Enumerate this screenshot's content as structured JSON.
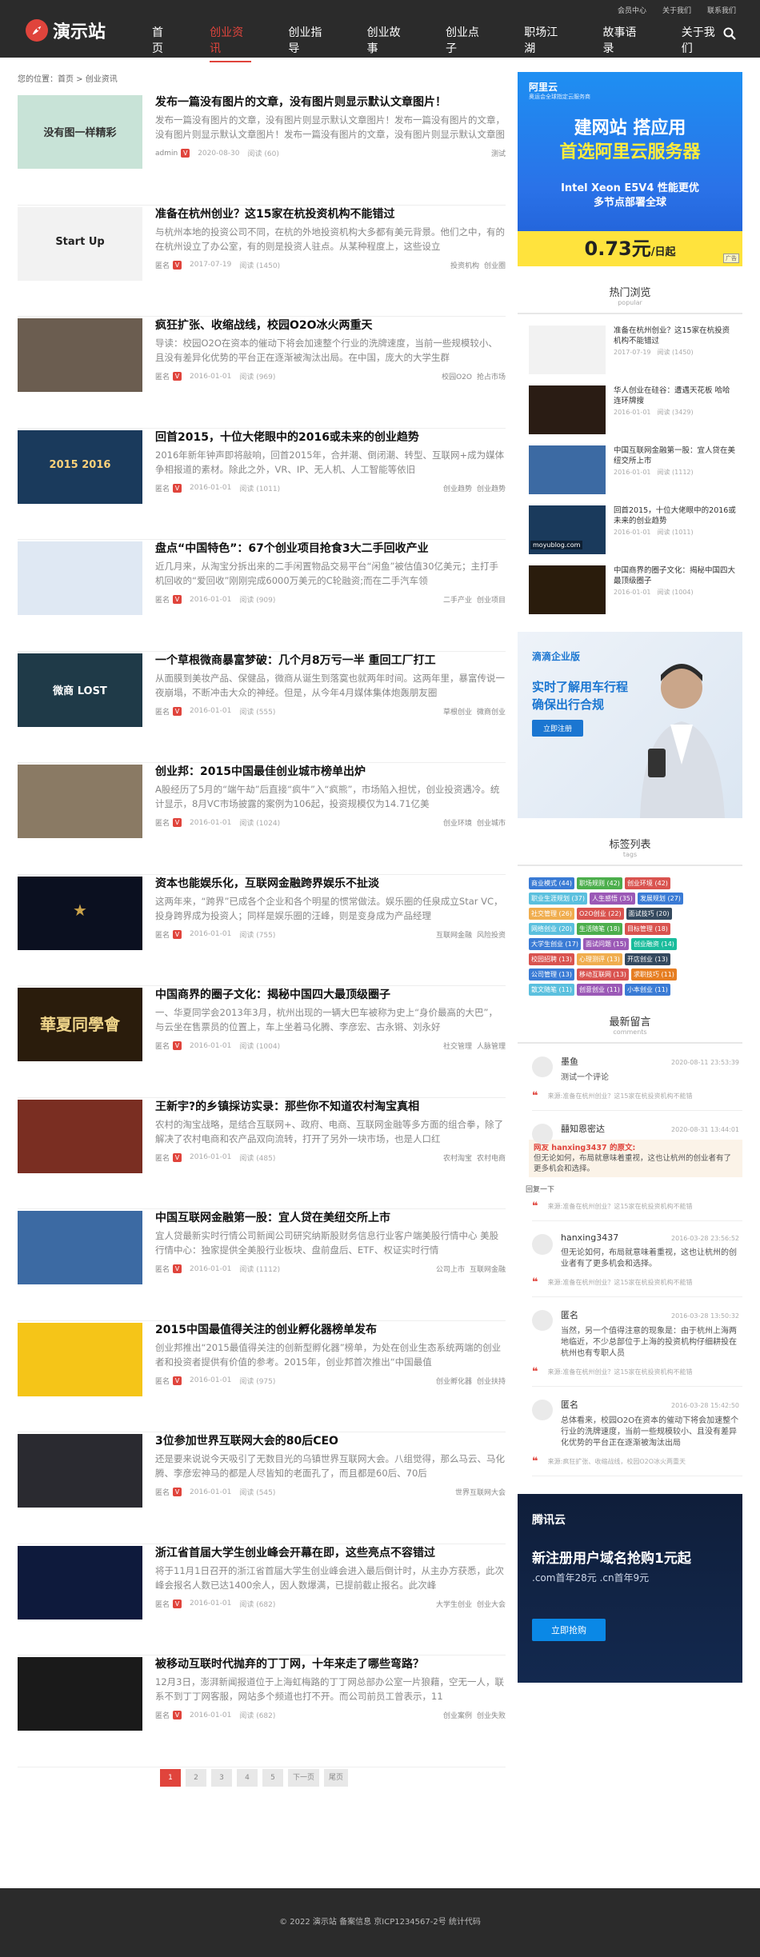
{
  "topbar": [
    "会员中心",
    "关于我们",
    "联系我们"
  ],
  "logo": {
    "text": "演示站"
  },
  "nav": [
    {
      "label": "首页",
      "active": false
    },
    {
      "label": "创业资讯",
      "active": true
    },
    {
      "label": "创业指导",
      "active": false
    },
    {
      "label": "创业故事",
      "active": false
    },
    {
      "label": "创业点子",
      "active": false
    },
    {
      "label": "职场江湖",
      "active": false
    },
    {
      "label": "故事语录",
      "active": false
    },
    {
      "label": "关于我们",
      "active": false
    }
  ],
  "breadcrumb": "您的位置：首页 > 创业资讯",
  "articles": [
    {
      "title": "发布一篇没有图片的文章，没有图片则显示默认文章图片！",
      "excerpt": "发布一篇没有图片的文章，没有图片则显示默认文章图片！发布一篇没有图片的文章，没有图片则显示默认文章图片！发布一篇没有图片的文章，没有图片则显示默认文章图片！",
      "author": "admin",
      "date": "2020-08-30",
      "views": "阅读 (60)",
      "tags": [
        "测试"
      ],
      "thumb_text": "没有图一样精彩",
      "thumb_bg": "#c8e3d7",
      "thumb_fg": "#333"
    },
    {
      "title": "准备在杭州创业？这15家在杭投资机构不能错过",
      "excerpt": "与杭州本地的投资公司不同，在杭的外地投资机构大多都有美元背景。他们之中，有的在杭州设立了办公室，有的则是投资人驻点。从某种程度上，这些设立",
      "author": "匿名",
      "date": "2017-07-19",
      "views": "阅读 (1450)",
      "tags": [
        "投资机构",
        "创业圈"
      ],
      "thumb_text": "Start Up",
      "thumb_bg": "#f2f2f2",
      "thumb_fg": "#222"
    },
    {
      "title": "疯狂扩张、收缩战线，校园O2O冰火两重天",
      "excerpt": "导读：校园O2O在资本的催动下将会加速整个行业的洗牌速度，当前一些规模较小、且没有差异化优势的平台正在逐渐被淘汰出局。在中国，庞大的大学生群",
      "author": "匿名",
      "date": "2016-01-01",
      "views": "阅读 (969)",
      "tags": [
        "校园O2O",
        "抢占市场"
      ],
      "thumb_text": "",
      "thumb_bg": "#6b5d50",
      "thumb_fg": "#fff"
    },
    {
      "title": "回首2015，十位大佬眼中的2016或未来的创业趋势",
      "excerpt": "2016年新年钟声即将敲响，回首2015年，合并潮、倒闭潮、转型、互联网+成为媒体争相报道的素材。除此之外，VR、IP、无人机、人工智能等依旧",
      "author": "匿名",
      "date": "2016-01-01",
      "views": "阅读 (1011)",
      "tags": [
        "创业趋势",
        "创业趋势"
      ],
      "thumb_text": "2015 2016",
      "thumb_bg": "#1a3a5c",
      "thumb_fg": "#ffd27a"
    },
    {
      "title": "盘点“中国特色”：67个创业项目抢食3大二手回收产业",
      "excerpt": "近几月来，从淘宝分拆出来的二手闲置物品交易平台“闲鱼”被估值30亿美元；主打手机回收的“爱回收”刚刚完成6000万美元的C轮融资;而在二手汽车领",
      "author": "匿名",
      "date": "2016-01-01",
      "views": "阅读 (909)",
      "tags": [
        "二手产业",
        "创业项目"
      ],
      "thumb_text": "",
      "thumb_bg": "#dfe8f3",
      "thumb_fg": "#333"
    },
    {
      "title": "一个草根微商暴富梦破：几个月8万亏一半 重回工厂打工",
      "excerpt": "从面膜到美妆产品、保健品，微商从诞生到落寞也就两年时间。这两年里，暴富传说一夜崩塌，不断冲击大众的神经。但是，从今年4月媒体集体炮轰朋友圈",
      "author": "匿名",
      "date": "2016-01-01",
      "views": "阅读 (555)",
      "tags": [
        "草根创业",
        "微商创业"
      ],
      "thumb_text": "微商 LOST",
      "thumb_bg": "#1f3a48",
      "thumb_fg": "#fff"
    },
    {
      "title": "创业邦：2015中国最佳创业城市榜单出炉",
      "excerpt": "A股经历了5月的“端午劫”后直接“疯牛”入“疯熊”，市场陷入担忧，创业投资遇冷。统计显示，8月VC市场披露的案例为106起，投资规模仅为14.71亿美",
      "author": "匿名",
      "date": "2016-01-01",
      "views": "阅读 (1024)",
      "tags": [
        "创业环境",
        "创业城市"
      ],
      "thumb_text": "",
      "thumb_bg": "#8a7a64",
      "thumb_fg": "#fff"
    },
    {
      "title": "资本也能娱乐化，互联网金融跨界娱乐不扯淡",
      "excerpt": "这两年来，“跨界”已成各个企业和各个明星的惯常做法。娱乐圈的任泉成立Star VC，投身跨界成为投资人；同样是娱乐圈的汪峰，则是变身成为产品经理",
      "author": "匿名",
      "date": "2016-01-01",
      "views": "阅读 (755)",
      "tags": [
        "互联网金融",
        "风险投资"
      ],
      "thumb_text": "★",
      "thumb_bg": "#0b1020",
      "thumb_fg": "#c9a24a"
    },
    {
      "title": "中国商界的圈子文化：揭秘中国四大最顶级圈子",
      "excerpt": "一、华夏同学会2013年3月，杭州出现的一辆大巴车被称为史上“身价最高的大巴”，与云坐在售票员的位置上，车上坐着马化腾、李彦宏、古永锵、刘永好",
      "author": "匿名",
      "date": "2016-01-01",
      "views": "阅读 (1004)",
      "tags": [
        "社交管理",
        "人脉管理"
      ],
      "thumb_text": "華夏同學會",
      "thumb_bg": "#2a1c0c",
      "thumb_fg": "#f0d58a"
    },
    {
      "title": "王新宇?的乡镇採访实录：那些你不知道农村淘宝真相",
      "excerpt": "农村的淘宝战略，是结合互联网+、政府、电商、互联网金融等多方面的组合拳，除了解决了农村电商和农产品双向流转，打开了另外一块市场，也是人口红",
      "author": "匿名",
      "date": "2016-01-01",
      "views": "阅读 (485)",
      "tags": [
        "农村淘宝",
        "农村电商"
      ],
      "thumb_text": "",
      "thumb_bg": "#7a2e22",
      "thumb_fg": "#fff"
    },
    {
      "title": "中国互联网金融第一股：宜人贷在美纽交所上市",
      "excerpt": "宜人贷最新实时行情公司新闻公司研究纳斯股财务信息行业客户端美股行情中心 美股行情中心：独家提供全美股行业板块、盘前盘后、ETF、权证实时行情",
      "author": "匿名",
      "date": "2016-01-01",
      "views": "阅读 (1112)",
      "tags": [
        "公司上市",
        "互联网金融"
      ],
      "thumb_text": "",
      "thumb_bg": "#3c6aa3",
      "thumb_fg": "#fff"
    },
    {
      "title": "2015中国最值得关注的创业孵化器榜单发布",
      "excerpt": "创业邦推出“2015最值得关注的创新型孵化器”榜单，为处在创业生态系统两端的创业者和投资者提供有价值的参考。2015年，创业邦首次推出“中国最值",
      "author": "匿名",
      "date": "2016-01-01",
      "views": "阅读 (975)",
      "tags": [
        "创业孵化器",
        "创业扶持"
      ],
      "thumb_text": "",
      "thumb_bg": "#f5c518",
      "thumb_fg": "#c00"
    },
    {
      "title": "3位参加世界互联网大会的80后CEO",
      "excerpt": "还是要来说说今天吸引了无数目光的乌镇世界互联网大会。八组觉得，那么马云、马化腾、李彦宏神马的都是人尽皆知的老面孔了，而且都是60后、70后",
      "author": "匿名",
      "date": "2016-01-01",
      "views": "阅读 (545)",
      "tags": [
        "世界互联网大会"
      ],
      "thumb_text": "",
      "thumb_bg": "#2a2a30",
      "thumb_fg": "#fff"
    },
    {
      "title": "浙江省首届大学生创业峰会开幕在即，这些亮点不容错过",
      "excerpt": "将于11月1日召开的浙江省首届大学生创业峰会进入最后倒计时，从主办方获悉，此次峰会报名人数已达1400余人，因人数爆满，已提前截止报名。此次峰",
      "author": "匿名",
      "date": "2016-01-01",
      "views": "阅读 (682)",
      "tags": [
        "大学生创业",
        "创业大会"
      ],
      "thumb_text": "",
      "thumb_bg": "#0e1a3c",
      "thumb_fg": "#fff"
    },
    {
      "title": "被移动互联时代抛弃的丁丁网，十年来走了哪些弯路？",
      "excerpt": "12月3日，澎湃新闻报道位于上海虹梅路的丁丁网总部办公室一片狼藉，空无一人，联系不到丁丁网客服，网站多个频道也打不开。而公司前员工曾表示，11",
      "author": "匿名",
      "date": "2016-01-01",
      "views": "阅读 (682)",
      "tags": [
        "创业案例",
        "创业失败"
      ],
      "thumb_text": "",
      "thumb_bg": "#1a1a1a",
      "thumb_fg": "#fff"
    }
  ],
  "pager": [
    "1",
    "2",
    "3",
    "4",
    "5",
    "下一页",
    "尾页"
  ],
  "aliyun_ad": {
    "brand": "阿里云",
    "sub": "奥运会全球指定云服务商",
    "h1": "建网站 搭应用",
    "h2": "首选阿里云服务器",
    "h3": "Intel Xeon E5V4 性能更优",
    "h4": "多节点部署全球",
    "price": "0.73元",
    "unit": "/日起",
    "tag": "广告"
  },
  "hot": {
    "title": "热门浏览",
    "sub": "popular",
    "items": [
      {
        "title": "准备在杭州创业？这15家在杭投资机构不能错过",
        "date": "2017-07-19",
        "views": "阅读 (1450)",
        "bg": "#f2f2f2"
      },
      {
        "title": "华人创业在硅谷：遭遇天花板 哈哈连环牌搜",
        "date": "2016-01-01",
        "views": "阅读 (3429)",
        "bg": "#2a1c14"
      },
      {
        "title": "中国互联网金融第一股：宜人贷在美纽交所上市",
        "date": "2016-01-01",
        "views": "阅读 (1112)",
        "bg": "#3c6aa3"
      },
      {
        "title": "回首2015，十位大佬眼中的2016或未来的创业趋势",
        "date": "2016-01-01",
        "views": "阅读 (1011)",
        "bg": "#1a3a5c"
      },
      {
        "title": "中国商界的圈子文化：揭秘中国四大最顶级圈子",
        "date": "2016-01-01",
        "views": "阅读 (1004)",
        "bg": "#2a1c0c"
      }
    ],
    "watermark": "moyublog.com"
  },
  "didi_ad": {
    "brand": "滴滴企业版",
    "line1": "实时了解用车行程",
    "line2": "确保出行合规",
    "button": "立即注册"
  },
  "tags_box": {
    "title": "标签列表",
    "sub": "tags",
    "items": [
      {
        "label": "商业模式 (44)",
        "color": "#3a7bd5"
      },
      {
        "label": "职场规则 (42)",
        "color": "#4cae4c"
      },
      {
        "label": "创业环境 (42)",
        "color": "#d9534f"
      },
      {
        "label": "职业生涯规划 (37)",
        "color": "#5bc0de"
      },
      {
        "label": "人生感悟 (35)",
        "color": "#9b59b6"
      },
      {
        "label": "发展规划 (27)",
        "color": "#3a7bd5"
      },
      {
        "label": "社交管理 (26)",
        "color": "#f0ad4e"
      },
      {
        "label": "O2O创业 (22)",
        "color": "#d9534f"
      },
      {
        "label": "面试技巧 (20)",
        "color": "#34495e"
      },
      {
        "label": "网络创业 (20)",
        "color": "#5bc0de"
      },
      {
        "label": "生活随笔 (18)",
        "color": "#4cae4c"
      },
      {
        "label": "目标管理 (18)",
        "color": "#d9534f"
      },
      {
        "label": "大学生创业 (17)",
        "color": "#3a7bd5"
      },
      {
        "label": "面试问题 (15)",
        "color": "#9b59b6"
      },
      {
        "label": "创业融资 (14)",
        "color": "#1abc9c"
      },
      {
        "label": "校园招聘 (13)",
        "color": "#d9534f"
      },
      {
        "label": "心理测评 (13)",
        "color": "#f0ad4e"
      },
      {
        "label": "开店创业 (13)",
        "color": "#34495e"
      },
      {
        "label": "公司管理 (13)",
        "color": "#3a7bd5"
      },
      {
        "label": "移动互联网 (13)",
        "color": "#d9534f"
      },
      {
        "label": "求职技巧 (11)",
        "color": "#e67e22"
      },
      {
        "label": "散文随笔 (11)",
        "color": "#5bc0de"
      },
      {
        "label": "创意创业 (11)",
        "color": "#9b59b6"
      },
      {
        "label": "小本创业 (11)",
        "color": "#3a7bd5"
      }
    ]
  },
  "comments": {
    "title": "最新留言",
    "sub": "comments",
    "reply_label": "回复一下",
    "items": [
      {
        "name": "墨鱼",
        "time": "2020-08-11 23:53:39",
        "text": "测试一个评论",
        "quote": "",
        "quote_name": "",
        "from": "来源:准备在杭州创业？这15家在杭投资机构不能错"
      },
      {
        "name": "囍知恩密达",
        "time": "2020-08-31 13:44:01",
        "text": "",
        "quote_name": "网友 hanxing3437 的原文:",
        "quote": "但无论如何，布局就意味着重视，这也让杭州的创业者有了更多机会和选择。",
        "from": "来源:准备在杭州创业？这15家在杭投资机构不能错"
      },
      {
        "name": "hanxing3437",
        "time": "2016-03-28 23:56:52",
        "text": "但无论如何，布局就意味着重视，这也让杭州的创业者有了更多机会和选择。",
        "quote_name": "",
        "quote": "",
        "from": "来源:准备在杭州创业？这15家在杭投资机构不能错"
      },
      {
        "name": "匿名",
        "time": "2016-03-28 13:50:32",
        "text": "当然，另一个值得注意的现象是：由于杭州上海两地临近，不少总部位于上海的投资机构仔细耕投在杭州也有专职人员",
        "quote_name": "",
        "quote": "",
        "from": "来源:准备在杭州创业？这15家在杭投资机构不能错"
      },
      {
        "name": "匿名",
        "time": "2016-03-28 15:42:50",
        "text": "总体看来，校园O2O在资本的催动下将会加速整个行业的洗牌速度，当前一些规模较小、且没有差异化优势的平台正在逐渐被淘汰出局",
        "quote_name": "",
        "quote": "",
        "from": "来源:疯狂扩张、收缩战线，校园O2O冰火两重天"
      }
    ]
  },
  "tencent_ad": {
    "brand": "腾讯云",
    "line1": "新注册用户域名抢购1元起",
    "line2": ".com首年28元 .cn首年9元",
    "button": "立即抢购"
  },
  "footer": "© 2022 演示站 备案信息 京ICP1234567-2号 统计代码",
  "colors": {
    "accent": "#e0443c",
    "header_bg": "#2b2b2b"
  }
}
